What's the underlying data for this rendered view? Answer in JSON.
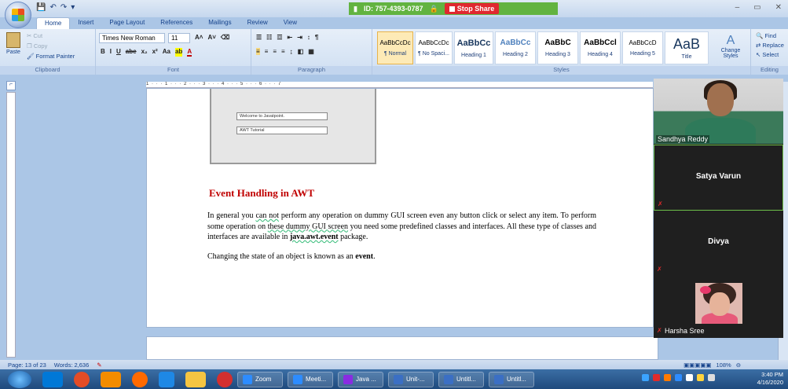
{
  "qat": {
    "undo": "↶",
    "redo": "↷",
    "customize": "▾"
  },
  "meeting_bar": {
    "id_label": "ID: 757-4393-0787",
    "stop_share": "Stop Share"
  },
  "window_controls": {
    "min": "–",
    "max": "▭",
    "close": "✕"
  },
  "tabs": [
    {
      "label": "Home"
    },
    {
      "label": "Insert"
    },
    {
      "label": "Page Layout"
    },
    {
      "label": "References"
    },
    {
      "label": "Mailings"
    },
    {
      "label": "Review"
    },
    {
      "label": "View"
    }
  ],
  "clipboard": {
    "paste": "Paste",
    "cut": "Cut",
    "copy": "Copy",
    "format_painter": "Format Painter",
    "label": "Clipboard"
  },
  "font": {
    "name": "Times New Roman",
    "size": "11",
    "label": "Font",
    "grow": "A˄",
    "shrink": "A˅",
    "clear": "Aa",
    "bold": "B",
    "italic": "I",
    "underline": "U",
    "strike": "abe",
    "sub": "x₂",
    "sup": "x²",
    "case": "Aa",
    "highlight": "ab",
    "color": "A"
  },
  "paragraph": {
    "label": "Paragraph"
  },
  "styles": {
    "label": "Styles",
    "items": [
      {
        "preview": "AaBbCcDc",
        "name": "¶ Normal"
      },
      {
        "preview": "AaBbCcDc",
        "name": "¶ No Spaci..."
      },
      {
        "preview": "AaBbCc",
        "name": "Heading 1"
      },
      {
        "preview": "AaBbCc",
        "name": "Heading 2"
      },
      {
        "preview": "AaBbC",
        "name": "Heading 3"
      },
      {
        "preview": "AaBbCcl",
        "name": "Heading 4"
      },
      {
        "preview": "AaBbCcD",
        "name": "Heading 5"
      },
      {
        "preview": "AaB",
        "name": "Title"
      }
    ],
    "change": "Change Styles"
  },
  "editing": {
    "label": "Editing",
    "find": "Find",
    "replace": "Replace",
    "select": "Select"
  },
  "ruler": {
    "marks": "1 · · · 1 · · · 2 · · · 3 · · · 4 · · · 5 · · · 6 · · · 7"
  },
  "document": {
    "screenshot_field1": "Welcome to Javatpoint.",
    "screenshot_field2": "AWT Tutorial",
    "heading": "Event Handling in AWT",
    "para1_a": "In general you ",
    "para1_b": "can not",
    "para1_c": " perform any operation on dummy GUI screen even any button click or select any item. To perform some operation on ",
    "para1_d": "these dummy GUI screen",
    "para1_e": " you need some predefined classes and interfaces. All these type of classes and interfaces are available in ",
    "para1_f": "java.awt.event",
    "para1_g": " package.",
    "para2_a": "Changing the state of an object is known as an ",
    "para2_b": "event",
    "para2_c": "."
  },
  "status": {
    "page": "Page: 13 of 23",
    "words": "Words: 2,636",
    "zoom": "108%"
  },
  "participants": [
    {
      "name": "Sandhya Reddy"
    },
    {
      "name": "Satya Varun"
    },
    {
      "name": "Divya"
    },
    {
      "name": "Harsha Sree"
    }
  ],
  "taskbar": {
    "items": [
      {
        "label": "Zoom",
        "color": "#2d8cff"
      },
      {
        "label": "Meeti...",
        "color": "#2d8cff"
      },
      {
        "label": "Java ...",
        "color": "#8a2be2"
      },
      {
        "label": "Unit-...",
        "color": "#3b6fc4"
      },
      {
        "label": "Untitl...",
        "color": "#3b6fc4"
      },
      {
        "label": "Untitl...",
        "color": "#3b6fc4"
      }
    ],
    "time": "3:40 PM",
    "date": "4/16/2020"
  }
}
